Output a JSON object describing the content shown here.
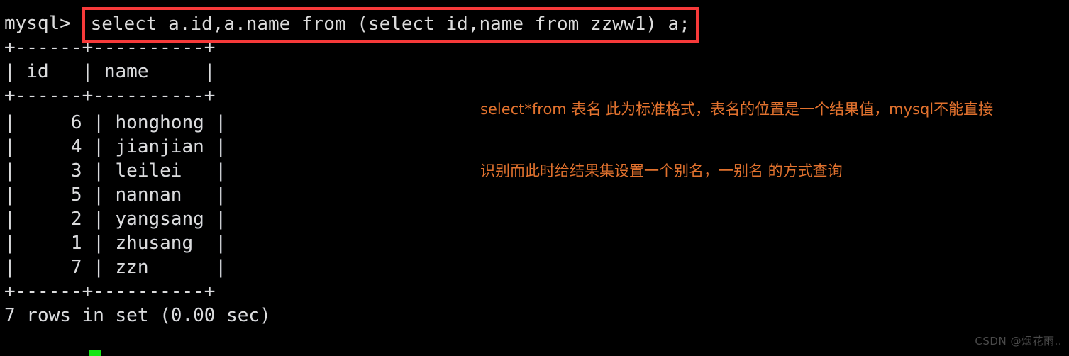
{
  "terminal": {
    "prompt": "mysql> ",
    "command": "select a.id,a.name from (select id,name from zzww1) a;",
    "separator": "+------+----------+",
    "header_row": "|  id   |  name     |",
    "header": {
      "id_label": "id",
      "name_label": "name"
    },
    "rows": [
      {
        "id": "6",
        "name": "honghong",
        "line": "|     6 | honghong |"
      },
      {
        "id": "4",
        "name": "jianjian",
        "line": "|     4 | jianjian |"
      },
      {
        "id": "3",
        "name": "leilei",
        "line": "|     3 | leilei   |"
      },
      {
        "id": "5",
        "name": "nannan",
        "line": "|     5 | nannan   |"
      },
      {
        "id": "2",
        "name": "yangsang",
        "line": "|     2 | yangsang |"
      },
      {
        "id": "1",
        "name": "zhusang",
        "line": "|     1 | zhusang  |"
      },
      {
        "id": "7",
        "name": "zzn",
        "line": "|     7 | zzn      |"
      }
    ],
    "header_line": "| id   | name     |",
    "result_status": "7 rows in set (0.00 sec)",
    "row_count": "7",
    "elapsed": "0.00 sec",
    "cursor_color": "#15e615",
    "text_color": "#dcdcdc",
    "background_color": "#000000"
  },
  "highlight": {
    "box_color": "#f73a3a"
  },
  "annotation": {
    "color": "#e2722e",
    "line1": "select*from 表名 此为标准格式，表名的位置是一个结果值，mysql不能直接",
    "line2": "识别而此时给结果集设置一个别名，一别名 的方式查询"
  },
  "watermark": {
    "text": "CSDN @烟花雨.."
  }
}
